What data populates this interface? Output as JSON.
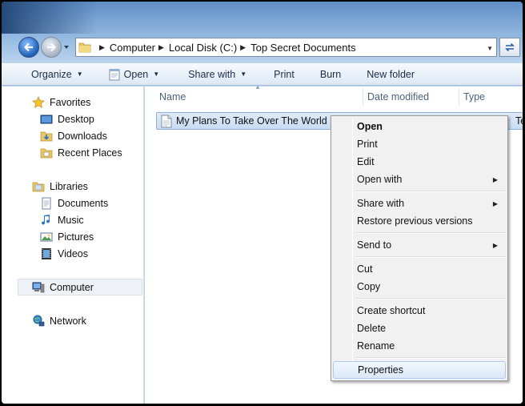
{
  "address": {
    "crumbs": [
      "Computer",
      "Local Disk (C:)",
      "Top Secret Documents"
    ]
  },
  "toolbar": {
    "organize": "Organize",
    "open": "Open",
    "share_with": "Share with",
    "print": "Print",
    "burn": "Burn",
    "new_folder": "New folder"
  },
  "nav": {
    "favorites": "Favorites",
    "desktop": "Desktop",
    "downloads": "Downloads",
    "recent_places": "Recent Places",
    "libraries": "Libraries",
    "documents": "Documents",
    "music": "Music",
    "pictures": "Pictures",
    "videos": "Videos",
    "computer": "Computer",
    "network": "Network"
  },
  "columns": {
    "name": "Name",
    "date_modified": "Date modified",
    "type": "Type"
  },
  "file": {
    "name": "My Plans To Take Over The World",
    "type_partial": "Text Documen"
  },
  "context_menu": {
    "open": "Open",
    "print": "Print",
    "edit": "Edit",
    "open_with": "Open with",
    "share_with": "Share with",
    "restore": "Restore previous versions",
    "send_to": "Send to",
    "cut": "Cut",
    "copy": "Copy",
    "create_shortcut": "Create shortcut",
    "delete": "Delete",
    "rename": "Rename",
    "properties": "Properties"
  }
}
